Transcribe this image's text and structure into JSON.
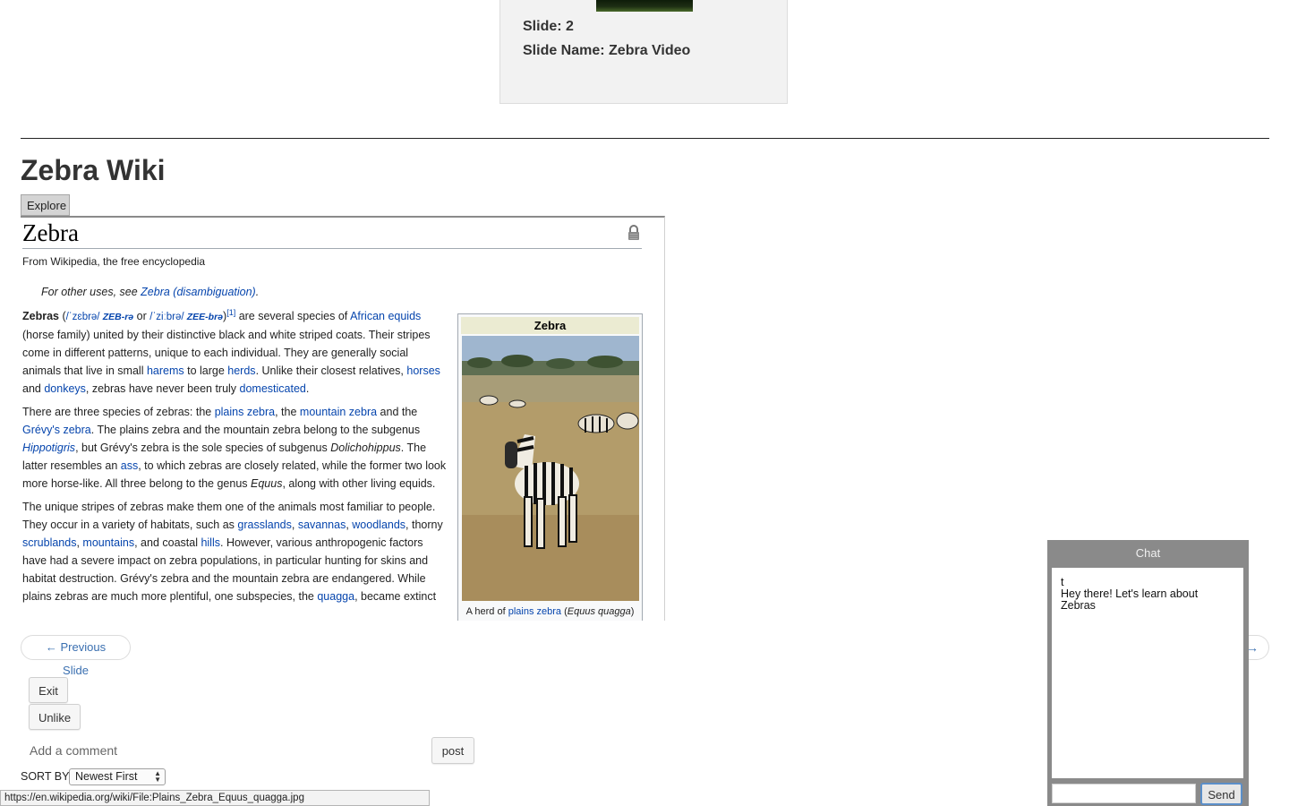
{
  "slide": {
    "number_line": "Slide: 2",
    "name_line": "Slide Name: Zebra Video"
  },
  "page_title": "Zebra Wiki",
  "explore_label": "Explore",
  "wiki": {
    "title": "Zebra",
    "subtitle": "From Wikipedia, the free encyclopedia",
    "hatnote_prefix": "For other uses, see ",
    "hatnote_link": "Zebra (disambiguation)",
    "hatnote_suffix": ".",
    "p1": {
      "lead": "Zebras",
      "ipa1": "/ˈzɛbrə/",
      "ipa1_resp": "ZEB-rə",
      "or": " or ",
      "ipa2": "/ˈziːbrə/",
      "ipa2_resp": "ZEE-brə",
      "ref": "[1]",
      "t1": " are several species of ",
      "l_african_equids": "African equids",
      "t2": " (horse family) united by their distinctive black and white striped coats. Their stripes come in different patterns, unique to each individual. They are generally social animals that live in small ",
      "l_harems": "harems",
      "t3": " to large ",
      "l_herds": "herds",
      "t4": ". Unlike their closest relatives, ",
      "l_horses": "horses",
      "t5": " and ",
      "l_donkeys": "donkeys",
      "t6": ", zebras have never been truly ",
      "l_domesticated": "domesticated",
      "t7": "."
    },
    "p2": {
      "t1": "There are three species of zebras: the ",
      "l_plains": "plains zebra",
      "t2": ", the ",
      "l_mountain": "mountain zebra",
      "t3": " and the ",
      "l_grevys": "Grévy's zebra",
      "t4": ". The plains zebra and the mountain zebra belong to the subgenus ",
      "l_hippotigris": "Hippotigris",
      "t5": ", but Grévy's zebra is the sole species of subgenus ",
      "i_dolichohippus": "Dolichohippus",
      "t6": ". The latter resembles an ",
      "l_ass": "ass",
      "t7": ", to which zebras are closely related, while the former two look more horse-like. All three belong to the genus ",
      "i_equus": "Equus",
      "t8": ", along with other living equids."
    },
    "p3": {
      "t1": "The unique stripes of zebras make them one of the animals most familiar to people. They occur in a variety of habitats, such as ",
      "l_grasslands": "grasslands",
      "c1": ", ",
      "l_savannas": "savannas",
      "c2": ", ",
      "l_woodlands": "woodlands",
      "t2": ", thorny ",
      "l_scrublands": "scrublands",
      "c3": ", ",
      "l_mountains": "mountains",
      "t3": ", and coastal ",
      "l_hills": "hills",
      "t4": ". However, various anthropogenic factors have had a severe impact on zebra populations, in particular hunting for skins and habitat destruction. Grévy's zebra and the mountain zebra are endangered. While plains zebras are much more plentiful, one subspecies, the ",
      "l_quagga": "quagga",
      "t5": ", became extinct"
    },
    "infobox": {
      "title": "Zebra",
      "caption_prefix": "A herd of ",
      "caption_link": "plains zebra",
      "caption_mid": " (",
      "caption_italic": "Equus quagga",
      "caption_suffix": ")"
    }
  },
  "nav": {
    "prev_label": "← Previous Slide",
    "next_label": "→"
  },
  "actions": {
    "exit_label": "Exit",
    "unlike_label": "Unlike",
    "comment_placeholder": "Add a comment",
    "post_label": "post",
    "sort_by_label": "SORT BY",
    "sort_selected": "Newest First"
  },
  "status_url": "https://en.wikipedia.org/wiki/File:Plains_Zebra_Equus_quagga.jpg",
  "chat": {
    "title": "Chat",
    "messages": [
      "t",
      "Hey there! Let's learn about Zebras"
    ],
    "send_label": "Send"
  },
  "colors": {
    "link": "#0645ad",
    "chat_frame": "#8a8a8a",
    "nav_text": "#3a6fb0"
  }
}
